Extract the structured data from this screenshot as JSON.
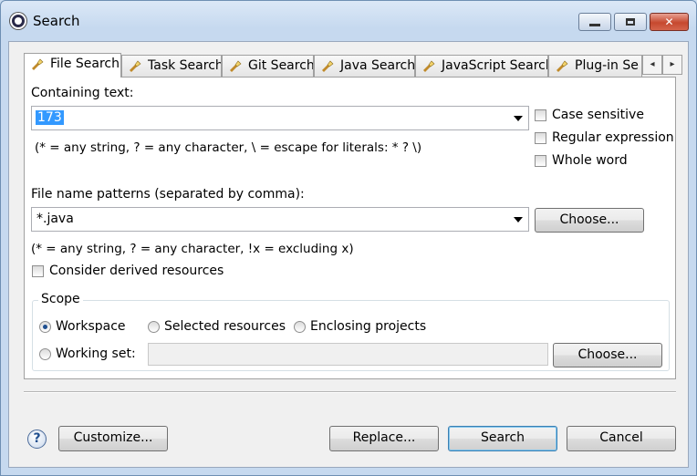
{
  "window": {
    "title": "Search",
    "controls": [
      "minimize",
      "maximize",
      "close"
    ]
  },
  "tabs": [
    {
      "label": "File Search",
      "icon": "flashlight-search-icon",
      "active": true
    },
    {
      "label": "Task Search",
      "icon": "task-search-icon",
      "active": false
    },
    {
      "label": "Git Search",
      "icon": "git-search-icon",
      "active": false
    },
    {
      "label": "Java Search",
      "icon": "java-search-icon",
      "active": false
    },
    {
      "label": "JavaScript Search",
      "icon": "javascript-search-icon",
      "active": false
    },
    {
      "label": "Plug-in Se",
      "icon": "plugin-search-icon",
      "active": false
    }
  ],
  "tab_scroll": {
    "left": "◂",
    "right": "▸"
  },
  "containing_text": {
    "label": "Containing text:",
    "value": "173",
    "hint": "(* = any string, ? = any character, \\ = escape for literals: * ? \\)"
  },
  "options": {
    "case_sensitive": {
      "label": "Case sensitive",
      "checked": false
    },
    "regular_expression": {
      "label": "Regular expression",
      "checked": false
    },
    "whole_word": {
      "label": "Whole word",
      "checked": false
    }
  },
  "file_patterns": {
    "label": "File name patterns (separated by comma):",
    "value": "*.java",
    "choose_label": "Choose...",
    "hint": "(* = any string, ? = any character, !x = excluding x)"
  },
  "derived": {
    "label": "Consider derived resources",
    "checked": false
  },
  "scope": {
    "title": "Scope",
    "workspace": {
      "label": "Workspace",
      "selected": true
    },
    "selected_resources": {
      "label": "Selected resources",
      "selected": false
    },
    "enclosing_projects": {
      "label": "Enclosing projects",
      "selected": false
    },
    "working_set": {
      "label": "Working set:",
      "selected": false,
      "value": ""
    },
    "choose_label": "Choose..."
  },
  "footer": {
    "help": "?",
    "customize": "Customize...",
    "replace": "Replace...",
    "search": "Search",
    "cancel": "Cancel"
  }
}
